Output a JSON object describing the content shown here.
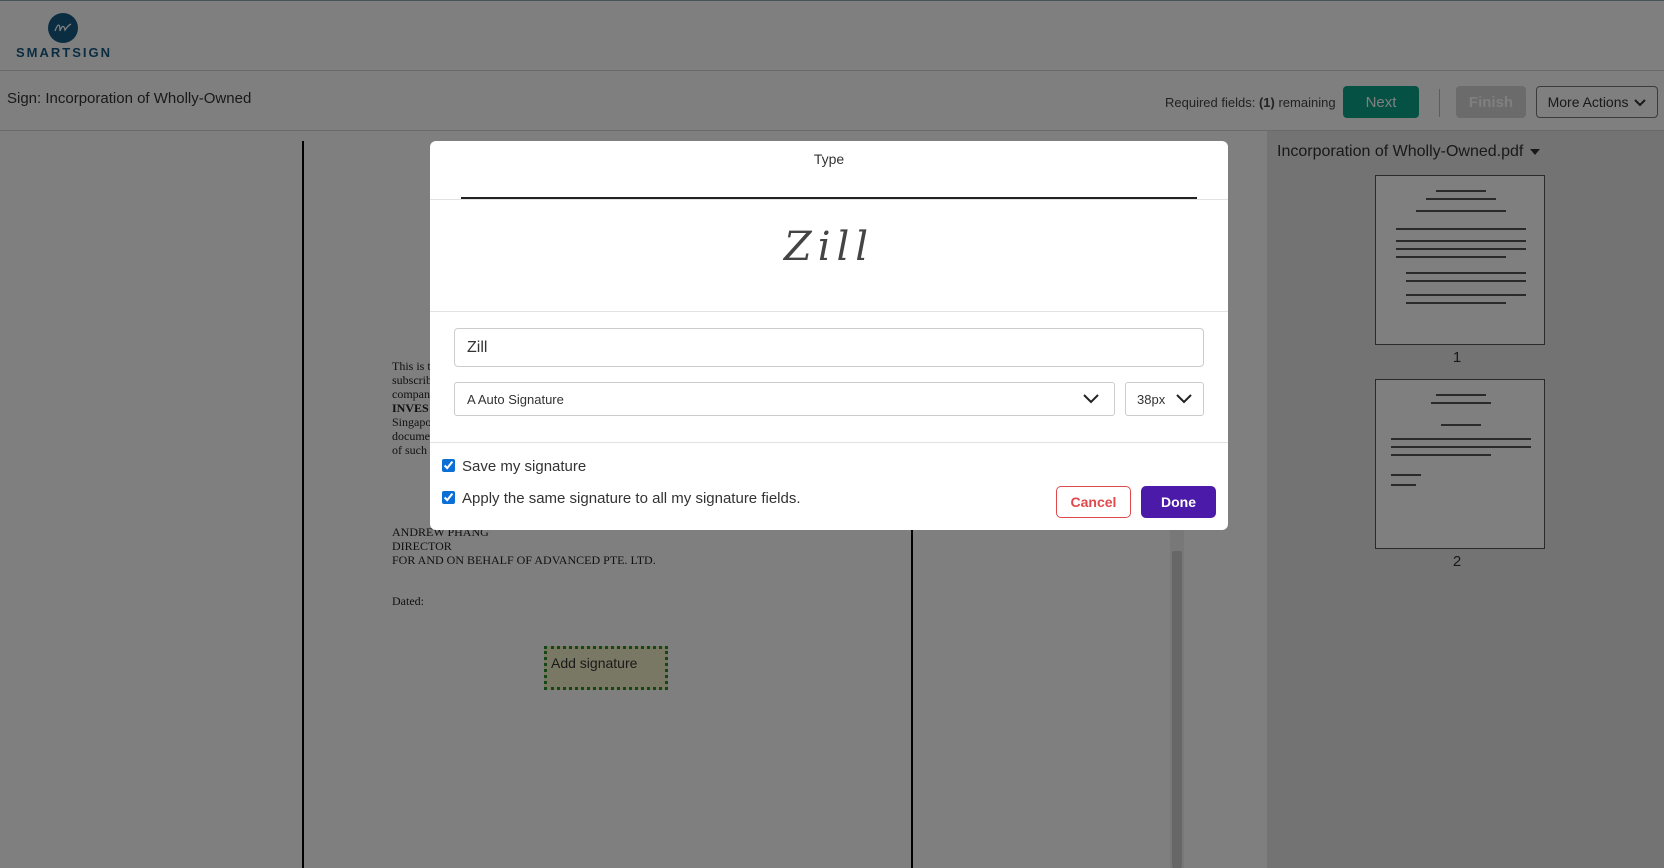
{
  "brand": {
    "name": "SMARTSIGN"
  },
  "header": {
    "title": "Sign: Incorporation of Wholly-Owned",
    "required_prefix": "Required fields:",
    "required_count": "(1)",
    "required_suffix": "remaining",
    "next_label": "Next",
    "finish_label": "Finish",
    "more_actions_label": "More Actions"
  },
  "document": {
    "text_fragments": [
      "This is t",
      "subscrib",
      "compan",
      "INVES",
      "Singapo",
      "docume",
      "of such"
    ],
    "signatory_name": "ANDREW PHANG",
    "signatory_title": "DIRECTOR",
    "signatory_company": "FOR AND ON BEHALF OF ADVANCED PTE. LTD.",
    "dated_label": "Dated:",
    "signature_field_label": "Add signature"
  },
  "thumbnails": {
    "file_name": "Incorporation of Wholly-Owned.pdf",
    "pages": [
      "1",
      "2"
    ]
  },
  "modal": {
    "tab_label": "Type",
    "preview_text": "Zill",
    "name_value": "Zill",
    "font_option": "A Auto Signature",
    "size_option": "38px",
    "save_signature_label": "Save my signature",
    "save_signature_checked": true,
    "apply_all_label": "Apply the same signature to all my signature fields.",
    "apply_all_checked": true,
    "cancel_label": "Cancel",
    "done_label": "Done"
  },
  "colors": {
    "brand": "#175a82",
    "next_button": "#0aa389",
    "done_button": "#4b1aa8",
    "cancel_button": "#e0494b"
  }
}
